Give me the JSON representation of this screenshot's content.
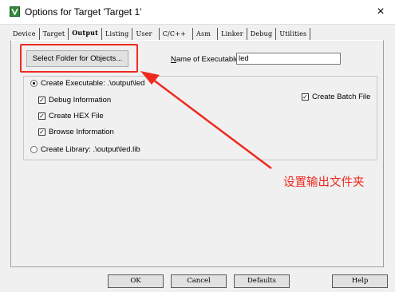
{
  "window": {
    "title": "Options for Target 'Target 1'",
    "close_glyph": "×",
    "icon": "keil-uvision-icon"
  },
  "tabs": [
    {
      "label": "Device",
      "active": false
    },
    {
      "label": "Target",
      "active": false
    },
    {
      "label": "Output",
      "active": true
    },
    {
      "label": "Listing",
      "active": false
    },
    {
      "label": "User",
      "active": false
    },
    {
      "label": "C/C++",
      "active": false
    },
    {
      "label": "Asm",
      "active": false
    },
    {
      "label": "Linker",
      "active": false
    },
    {
      "label": "Debug",
      "active": false
    },
    {
      "label": "Utilities",
      "active": false
    }
  ],
  "output": {
    "select_folder_label": "Select Folder for Objects...",
    "name_of_executable_label": "Name of Executable:",
    "name_of_executable_value": "led",
    "create_executable_label": "Create Executable:  .\\output\\led",
    "create_executable_selected": true,
    "debug_info_label": "Debug Information",
    "debug_info_checked": true,
    "create_hex_label": "Create HEX File",
    "create_hex_checked": true,
    "browse_info_label": "Browse Information",
    "browse_info_checked": true,
    "create_batch_label": "Create Batch File",
    "create_batch_checked": true,
    "create_library_label": "Create Library:  .\\output\\led.lib",
    "create_library_selected": false,
    "check_glyph": "✓"
  },
  "annotation": {
    "text": "设置输出文件夹",
    "color": "#ee2a20"
  },
  "buttons": {
    "ok": "OK",
    "cancel": "Cancel",
    "defaults": "Defaults",
    "help": "Help"
  }
}
